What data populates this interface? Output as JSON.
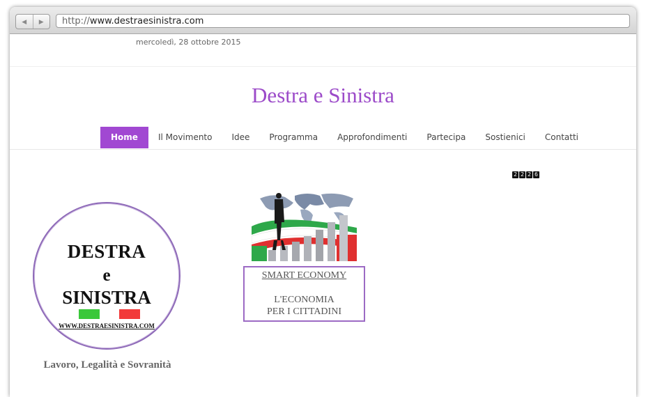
{
  "browser": {
    "url_prefix": "http://",
    "url_host": "www.destraesinistra.com"
  },
  "page": {
    "date": "mercoledì, 28 ottobre 2015",
    "site_title": "Destra e Sinistra",
    "menu": [
      {
        "label": "Home",
        "active": true
      },
      {
        "label": "Il Movimento"
      },
      {
        "label": "Idee"
      },
      {
        "label": "Programma"
      },
      {
        "label": "Approfondimenti"
      },
      {
        "label": "Partecipa"
      },
      {
        "label": "Sostienici"
      },
      {
        "label": "Contatti"
      }
    ],
    "visit_counter": [
      "2",
      "2",
      "2",
      "6"
    ],
    "logo": {
      "line1": "DESTRA",
      "line2": "e",
      "line3": "SINISTRA",
      "url": "WWW.DESTRAESINISTRA.COM"
    },
    "tagline": "Lavoro, Legalità e Sovranità",
    "smart_economy": {
      "title": "SMART ECONOMY",
      "line2": "L'ECONOMIA",
      "line3": "PER I CITTADINI"
    }
  },
  "colors": {
    "accent": "#a148d2",
    "title": "#9c4bc9",
    "flag_green": "#3ac83a",
    "flag_red": "#f23a3a"
  },
  "icons": {
    "back": "chevron-left-icon",
    "forward": "chevron-right-icon"
  }
}
